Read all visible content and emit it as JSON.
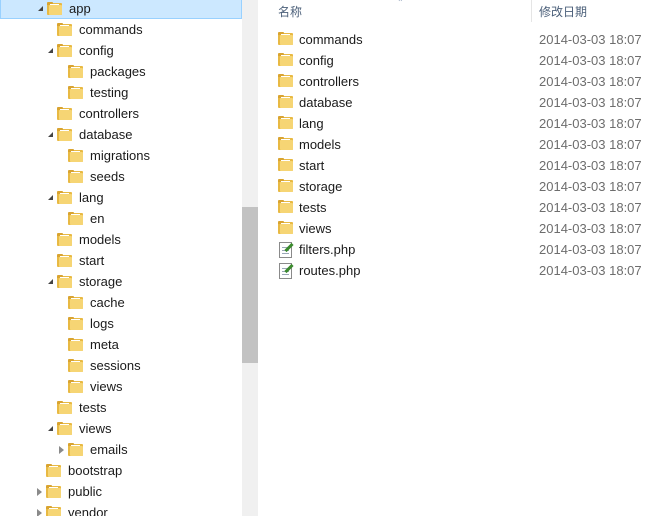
{
  "tree": {
    "items": [
      {
        "label": "app",
        "depth": 0,
        "toggle": "open",
        "selected": true
      },
      {
        "label": "commands",
        "depth": 1,
        "toggle": "none"
      },
      {
        "label": "config",
        "depth": 1,
        "toggle": "open"
      },
      {
        "label": "packages",
        "depth": 2,
        "toggle": "none"
      },
      {
        "label": "testing",
        "depth": 2,
        "toggle": "none"
      },
      {
        "label": "controllers",
        "depth": 1,
        "toggle": "none"
      },
      {
        "label": "database",
        "depth": 1,
        "toggle": "open"
      },
      {
        "label": "migrations",
        "depth": 2,
        "toggle": "none"
      },
      {
        "label": "seeds",
        "depth": 2,
        "toggle": "none"
      },
      {
        "label": "lang",
        "depth": 1,
        "toggle": "open"
      },
      {
        "label": "en",
        "depth": 2,
        "toggle": "none"
      },
      {
        "label": "models",
        "depth": 1,
        "toggle": "none"
      },
      {
        "label": "start",
        "depth": 1,
        "toggle": "none"
      },
      {
        "label": "storage",
        "depth": 1,
        "toggle": "open"
      },
      {
        "label": "cache",
        "depth": 2,
        "toggle": "none"
      },
      {
        "label": "logs",
        "depth": 2,
        "toggle": "none"
      },
      {
        "label": "meta",
        "depth": 2,
        "toggle": "none"
      },
      {
        "label": "sessions",
        "depth": 2,
        "toggle": "none"
      },
      {
        "label": "views",
        "depth": 2,
        "toggle": "none"
      },
      {
        "label": "tests",
        "depth": 1,
        "toggle": "none"
      },
      {
        "label": "views",
        "depth": 1,
        "toggle": "open"
      },
      {
        "label": "emails",
        "depth": 2,
        "toggle": "closed"
      },
      {
        "label": "bootstrap",
        "depth": 0,
        "toggle": "none"
      },
      {
        "label": "public",
        "depth": 0,
        "toggle": "closed"
      },
      {
        "label": "vendor",
        "depth": 0,
        "toggle": "closed"
      }
    ]
  },
  "list": {
    "header_name": "名称",
    "header_date": "修改日期",
    "files": [
      {
        "name": "commands",
        "date": "2014-03-03 18:07",
        "icon": "folder-icon"
      },
      {
        "name": "config",
        "date": "2014-03-03 18:07",
        "icon": "folder-icon"
      },
      {
        "name": "controllers",
        "date": "2014-03-03 18:07",
        "icon": "folder-icon"
      },
      {
        "name": "database",
        "date": "2014-03-03 18:07",
        "icon": "folder-icon"
      },
      {
        "name": "lang",
        "date": "2014-03-03 18:07",
        "icon": "folder-icon"
      },
      {
        "name": "models",
        "date": "2014-03-03 18:07",
        "icon": "folder-icon"
      },
      {
        "name": "start",
        "date": "2014-03-03 18:07",
        "icon": "folder-icon"
      },
      {
        "name": "storage",
        "date": "2014-03-03 18:07",
        "icon": "folder-icon"
      },
      {
        "name": "tests",
        "date": "2014-03-03 18:07",
        "icon": "folder-icon"
      },
      {
        "name": "views",
        "date": "2014-03-03 18:07",
        "icon": "folder-icon"
      },
      {
        "name": "filters.php",
        "date": "2014-03-03 18:07",
        "icon": "php-file-icon"
      },
      {
        "name": "routes.php",
        "date": "2014-03-03 18:07",
        "icon": "php-file-icon"
      }
    ]
  }
}
